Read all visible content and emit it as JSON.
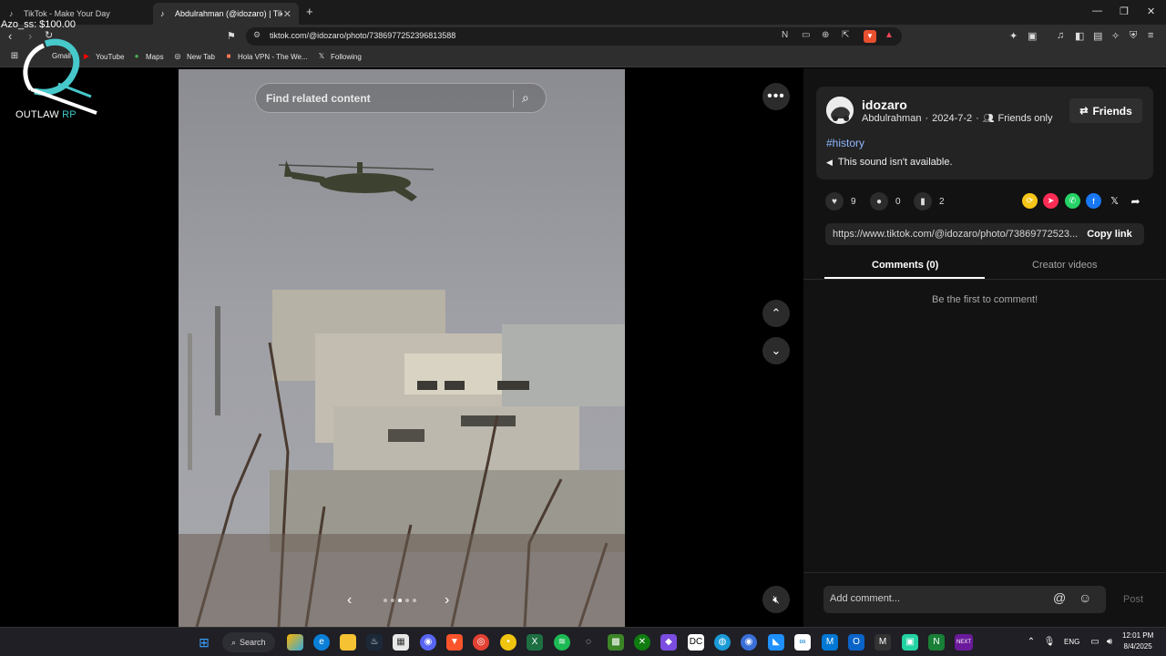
{
  "browser": {
    "tabs": [
      {
        "label": "TikTok - Make Your Day",
        "active": false
      },
      {
        "label": "Abdulrahman (@idozaro) | TikTo",
        "active": true
      }
    ],
    "new_tab": "+",
    "url": "tiktok.com/@idozaro/photo/7386977252396813588",
    "bookmarks": [
      "Gmail",
      "YouTube",
      "Maps",
      "New Tab",
      "Hola VPN - The We...",
      "Following"
    ]
  },
  "overlay": {
    "balance": "Azo_ss: $100.00",
    "logo_text": "OUTLAW",
    "logo_accent": "RP"
  },
  "viewer": {
    "search_placeholder": "Find related content",
    "carousel_dots": 5,
    "carousel_active": 3
  },
  "post": {
    "username": "idozaro",
    "display_name": "Abdulrahman",
    "date": "2024-7-2",
    "privacy": "Friends only",
    "friends_button": "Friends",
    "hashtag": "#history",
    "sound": "This sound isn't available.",
    "likes": "9",
    "comments": "0",
    "saves": "2",
    "link": "https://www.tiktok.com/@idozaro/photo/73869772523...",
    "copy_link": "Copy link"
  },
  "panel_tabs": {
    "comments": "Comments (0)",
    "creator_videos": "Creator videos",
    "empty": "Be the first to comment!"
  },
  "comment_box": {
    "placeholder": "Add comment...",
    "post": "Post"
  },
  "taskbar": {
    "search": "Search",
    "lang": "ENG",
    "time": "12:01 PM",
    "date": "8/4/2025"
  },
  "colors": {
    "accent_link": "#8fb7ff",
    "logo_accent": "#3ec8c8"
  }
}
